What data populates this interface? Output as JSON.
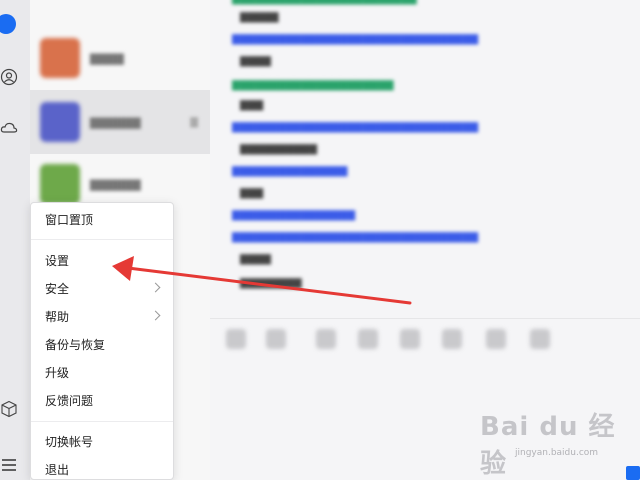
{
  "menu": {
    "items": [
      {
        "label": "窗口置顶"
      },
      {
        "label": "设置"
      },
      {
        "label": "安全"
      },
      {
        "label": "帮助"
      },
      {
        "label": "备份与恢复"
      },
      {
        "label": "升级"
      },
      {
        "label": "反馈问题"
      },
      {
        "label": "切换帐号"
      },
      {
        "label": "退出"
      }
    ]
  },
  "watermark": {
    "logo": "Bai du 经验",
    "url": "jingyan.baidu.com"
  },
  "colors": {
    "accent": "#1a6cf2",
    "arrow": "#e53935",
    "link_blue": "#3b5ce8",
    "link_green": "#2aa36b"
  }
}
